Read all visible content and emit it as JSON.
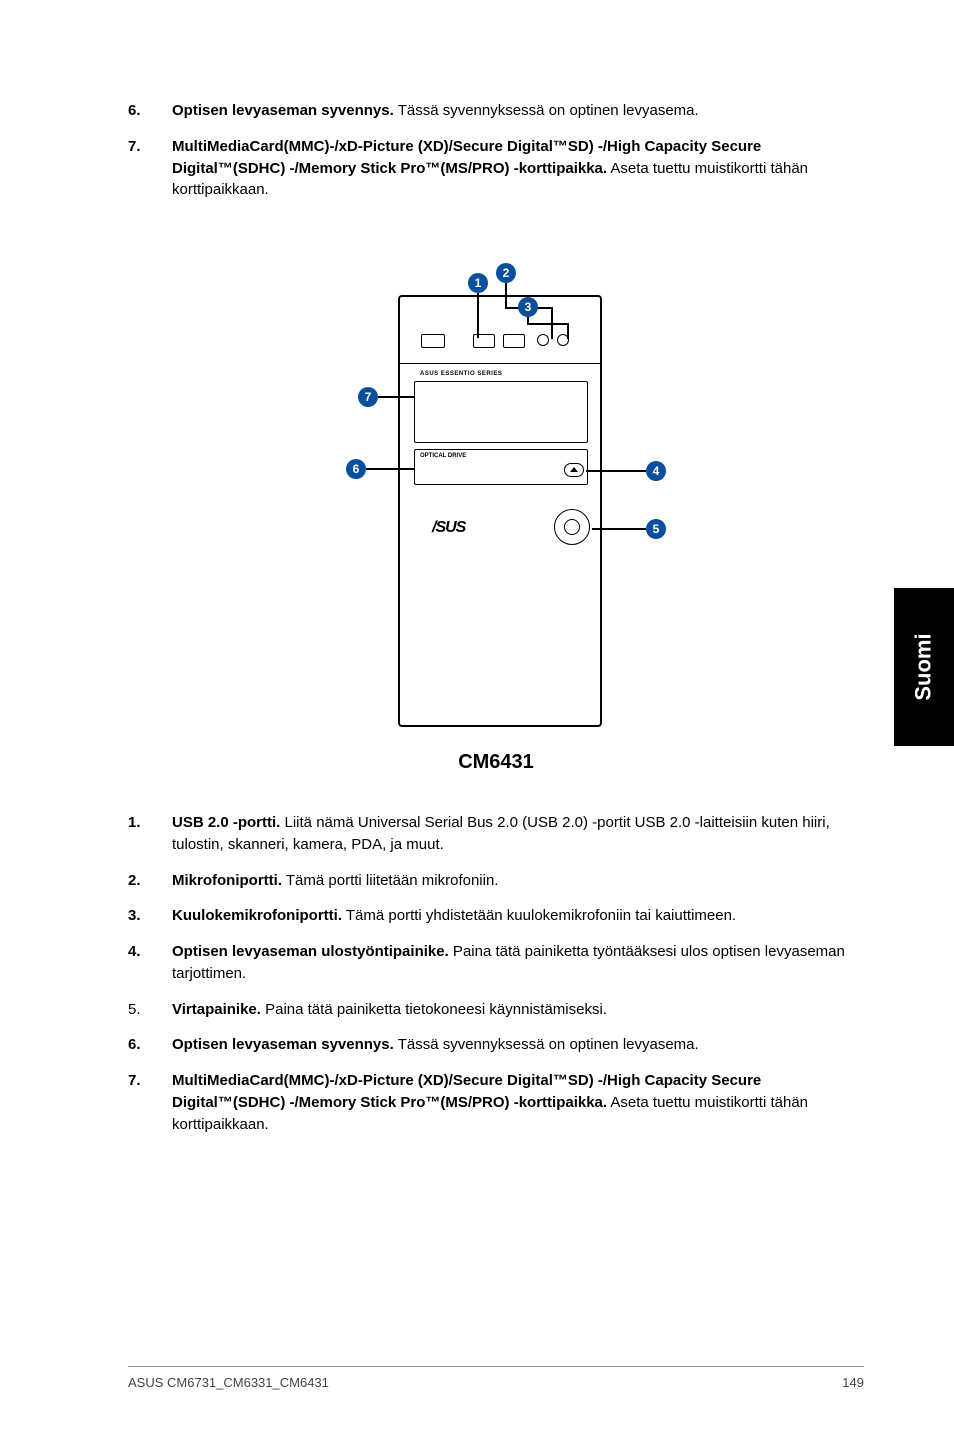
{
  "top": {
    "i6": {
      "n": "6.",
      "label": "Optisen levyaseman syvennys.",
      "rest": " Tässä syvennyksessä on optinen levyasema."
    },
    "i7": {
      "n": "7.",
      "label": "MultiMediaCard(MMC)-/xD-Picture (XD)/Secure Digital™SD) -/High Capacity Secure Digital™(SDHC) -/Memory Stick Pro™(MS/PRO) -korttipaikka.",
      "rest": " Aseta tuettu muistikortti tähän korttipaikkaan."
    }
  },
  "callouts": {
    "c1": "1",
    "c2": "2",
    "c3": "3",
    "c4": "4",
    "c5": "5",
    "c6": "6",
    "c7": "7"
  },
  "labels": {
    "series": "ASUS ESSENTIO SERIES",
    "drive": "OPTICAL DRIVE",
    "logo": "/SUS"
  },
  "caption": "CM6431",
  "bottom": {
    "i1": {
      "n": "1.",
      "label": "USB 2.0 -portti.",
      "rest": " Liitä nämä Universal Serial Bus 2.0 (USB 2.0) -portit USB 2.0 -laitteisiin kuten hiiri, tulostin, skanneri, kamera, PDA, ja muut."
    },
    "i2": {
      "n": "2.",
      "label": "Mikrofoniportti.",
      "rest": " Tämä portti liitetään mikrofoniin."
    },
    "i3": {
      "n": "3.",
      "label": "Kuulokemikrofoniportti.",
      "rest": " Tämä portti yhdistetään kuulokemikrofoniin tai kaiuttimeen."
    },
    "i4": {
      "n": "4.",
      "label": "Optisen levyaseman ulostyöntipainike.",
      "rest": " Paina tätä painiketta työntääksesi ulos optisen levyaseman tarjottimen."
    },
    "i5": {
      "n": "5.",
      "label": "Virtapainike.",
      "rest": " Paina tätä painiketta tietokoneesi käynnistämiseksi."
    },
    "i6": {
      "n": "6.",
      "label": "Optisen levyaseman syvennys.",
      "rest": " Tässä syvennyksessä on optinen levyasema."
    },
    "i7": {
      "n": "7.",
      "label": "MultiMediaCard(MMC)-/xD-Picture (XD)/Secure Digital™SD) -/High Capacity Secure Digital™(SDHC) -/Memory Stick Pro™(MS/PRO) -korttipaikka.",
      "rest": " Aseta tuettu muistikortti tähän korttipaikkaan."
    }
  },
  "sidetab": "Suomi",
  "footer": {
    "left": "ASUS CM6731_CM6331_CM6431",
    "right": "149"
  }
}
